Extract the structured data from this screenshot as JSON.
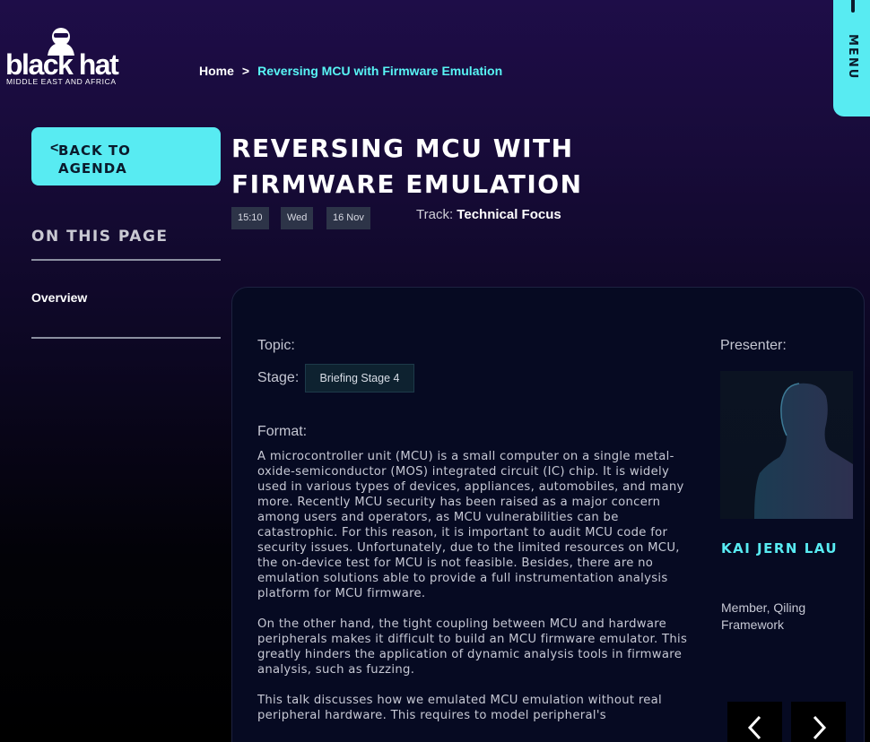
{
  "logo": {
    "wordmark": "black hat",
    "subtitle": "MIDDLE EAST AND AFRICA"
  },
  "breadcrumb": {
    "home": "Home",
    "separator": ">",
    "current": "Reversing MCU with Firmware Emulation"
  },
  "menu": {
    "label": "MENU"
  },
  "back_button": {
    "arrow": "<",
    "label": "Back to Agenda"
  },
  "session": {
    "title": "Reversing MCU with Firmware Emulation",
    "time": "15:10",
    "day": "Wed",
    "date": "16 Nov",
    "track_label": "Track:",
    "track_value": "Technical Focus"
  },
  "sidebar": {
    "heading": "On This Page",
    "links": [
      "Overview"
    ]
  },
  "details": {
    "topic_label": "Topic:",
    "stage_label": "Stage:",
    "stage_value": "Briefing Stage 4",
    "format_label": "Format:",
    "paragraphs": [
      "A microcontroller unit (MCU) is a small computer on a single metal-oxide-semiconductor (MOS) integrated circuit (IC) chip. It is widely used in various types of devices, appliances, automobiles, and many more. Recently MCU security has been raised as a major concern among users and operators, as MCU vulnerabilities can be catastrophic. For this reason, it is important to audit MCU code for security issues. Unfortunately, due to the limited resources on MCU, the on-device test for MCU is not feasible. Besides, there are no emulation solutions able to provide a full instrumentation analysis platform for MCU firmware.",
      "On the other hand, the tight coupling between MCU and hardware peripherals makes it difficult to build an MCU firmware emulator. This greatly hinders the application of dynamic analysis tools in firmware analysis, such as fuzzing.",
      "This talk discusses how we emulated MCU emulation without real peripheral hardware. This requires to model peripheral's"
    ]
  },
  "presenter": {
    "label": "Presenter:",
    "name": "Kai Jern Lau",
    "role": "Member, Qiling Framework"
  },
  "carousel": {
    "prev_icon": "chevron-left-icon",
    "next_icon": "chevron-right-icon"
  },
  "colors": {
    "accent": "#58ebf2",
    "background": "#1e0d48",
    "card": "#060a22"
  }
}
